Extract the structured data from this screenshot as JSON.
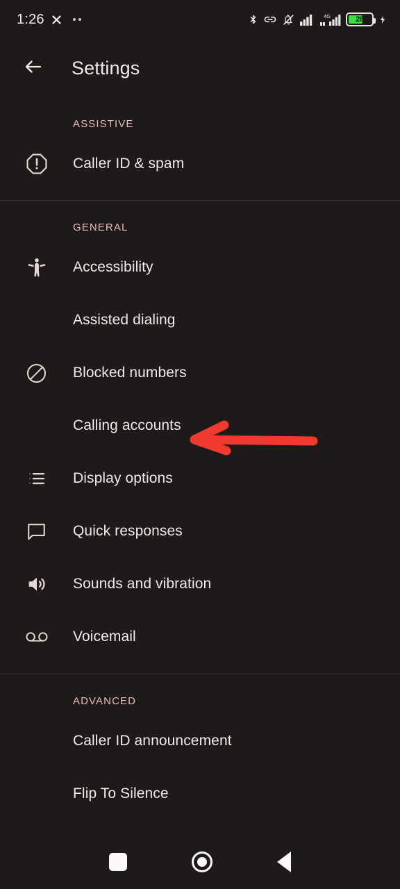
{
  "status_bar": {
    "time": "1:26",
    "battery_percent": "28",
    "network_label": "4G",
    "icons": [
      "close-x-icon",
      "more-dots-icon",
      "bluetooth-icon",
      "link-icon",
      "notifications-muted-icon",
      "signal-bars-icon",
      "signal-4g-icon",
      "battery-icon",
      "charging-bolt-icon"
    ]
  },
  "app_bar": {
    "title": "Settings",
    "back_icon": "arrow-left-icon"
  },
  "sections": [
    {
      "header": "ASSISTIVE",
      "items": [
        {
          "label": "Caller ID & spam",
          "icon": "warning-octagon-icon"
        }
      ]
    },
    {
      "header": "GENERAL",
      "items": [
        {
          "label": "Accessibility",
          "icon": "accessibility-person-icon"
        },
        {
          "label": "Assisted dialing",
          "icon": ""
        },
        {
          "label": "Blocked numbers",
          "icon": "block-circle-icon"
        },
        {
          "label": "Calling accounts",
          "icon": ""
        },
        {
          "label": "Display options",
          "icon": "list-bullets-icon"
        },
        {
          "label": "Quick responses",
          "icon": "speech-bubble-icon"
        },
        {
          "label": "Sounds and vibration",
          "icon": "speaker-volume-icon"
        },
        {
          "label": "Voicemail",
          "icon": "voicemail-icon"
        }
      ]
    },
    {
      "header": "ADVANCED",
      "items": [
        {
          "label": "Caller ID announcement",
          "icon": ""
        },
        {
          "label": "Flip To Silence",
          "icon": ""
        }
      ]
    }
  ],
  "annotation": {
    "type": "arrow-left-annotation",
    "color": "#f0392f",
    "points_to": "Calling accounts"
  },
  "nav_bar": {
    "recents_label": "Recents",
    "home_label": "Home",
    "back_label": "Back"
  },
  "colors": {
    "background": "#1e1a19",
    "text_primary": "#f0e9e8",
    "section_header": "#e6bdb8",
    "divider": "#3a3230",
    "battery_fill": "#3ddb45"
  }
}
